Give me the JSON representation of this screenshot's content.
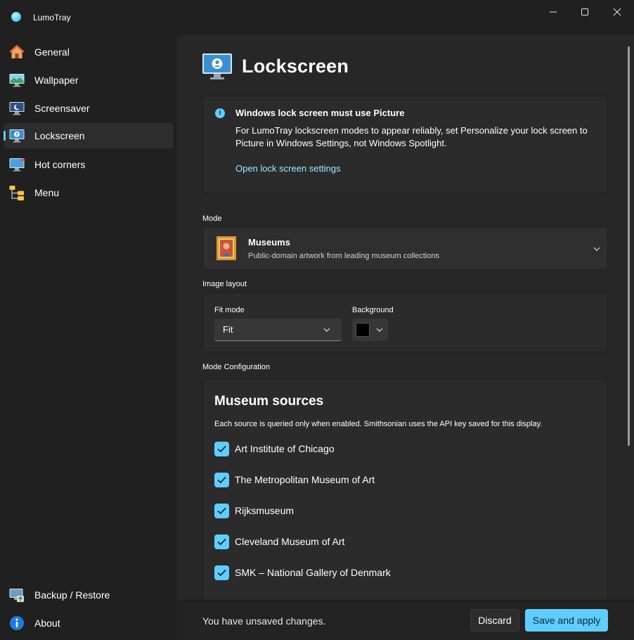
{
  "app": {
    "title": "LumoTray",
    "accent": "#60cdff",
    "window_controls": [
      "minimize-icon",
      "maximize-icon",
      "close-icon"
    ]
  },
  "sidebar": {
    "items": [
      {
        "label": "General",
        "icon": "home-icon",
        "active": false
      },
      {
        "label": "Wallpaper",
        "icon": "landscape-monitor-icon",
        "active": false
      },
      {
        "label": "Screensaver",
        "icon": "moon-monitor-icon",
        "active": false
      },
      {
        "label": "Lockscreen",
        "icon": "user-monitor-icon",
        "active": true
      },
      {
        "label": "Hot corners",
        "icon": "monitor-icon",
        "active": false
      },
      {
        "label": "Menu",
        "icon": "folder-tree-icon",
        "active": false
      }
    ],
    "footer_items": [
      {
        "label": "Backup / Restore",
        "icon": "backup-monitor-icon"
      },
      {
        "label": "About",
        "icon": "info-icon"
      }
    ]
  },
  "page": {
    "title": "Lockscreen",
    "icon": "user-monitor-icon"
  },
  "info_bar": {
    "title": "Windows lock screen must use Picture",
    "body": "For LumoTray lockscreen modes to appear reliably, set Personalize your lock screen to Picture in Windows Settings, not Windows Spotlight.",
    "link": "Open lock screen settings"
  },
  "mode": {
    "section_label": "Mode",
    "selected_name": "Museums",
    "selected_description": "Public-domain artwork from leading museum collections",
    "icon": "framed-painting-icon"
  },
  "image_layout": {
    "section_label": "Image layout",
    "fit_mode_label": "Fit mode",
    "fit_mode_value": "Fit",
    "background_label": "Background",
    "background_color": "#000000"
  },
  "mode_config": {
    "section_label": "Mode Configuration",
    "title": "Museum sources",
    "description": "Each source is queried only when enabled. Smithsonian uses the API key saved for this display.",
    "sources": [
      {
        "label": "Art Institute of Chicago",
        "checked": true
      },
      {
        "label": "The Metropolitan Museum of Art",
        "checked": true
      },
      {
        "label": "Rijksmuseum",
        "checked": true
      },
      {
        "label": "Cleveland Museum of Art",
        "checked": true
      },
      {
        "label": "SMK – National Gallery of Denmark",
        "checked": true
      }
    ]
  },
  "footer": {
    "status": "You have unsaved changes.",
    "discard_label": "Discard",
    "save_label": "Save and apply"
  }
}
